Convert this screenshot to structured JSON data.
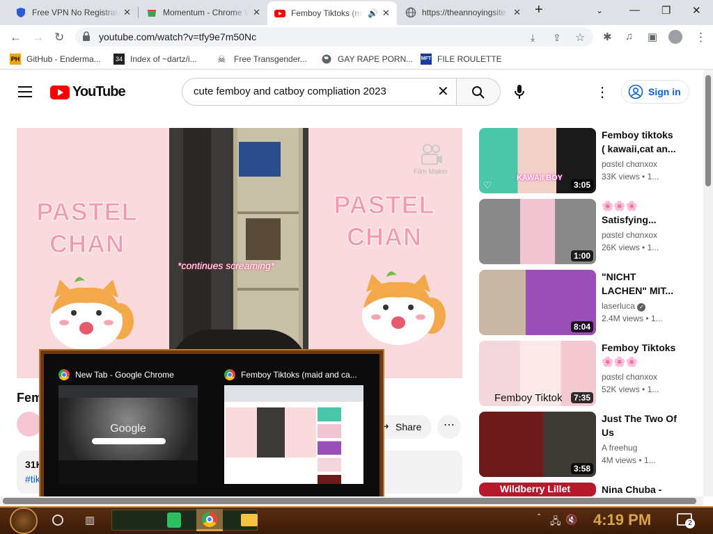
{
  "browser": {
    "tabs": [
      {
        "title": "Free VPN No Registration",
        "active": false
      },
      {
        "title": "Momentum - Chrome Web Store",
        "active": false
      },
      {
        "title": "Femboy Tiktoks (maid and catboy)",
        "active": true
      },
      {
        "title": "https://theannoyingsite.com",
        "active": false
      }
    ],
    "url": "youtube.com/watch?v=tfy9e7m50Nc",
    "bookmarks": [
      {
        "label": "GitHub - Enderma...",
        "icon": "PH"
      },
      {
        "label": "Index of ~dartz/i...",
        "icon": "34"
      },
      {
        "label": "Free Transgender...",
        "icon": "skull"
      },
      {
        "label": "GAY RAPE PORN...",
        "icon": "globe"
      },
      {
        "label": "FILE ROULETTE",
        "icon": "MFT"
      }
    ]
  },
  "youtube": {
    "logo_text": "YouTube",
    "search_query": "cute femboy and catboy compliation 2023",
    "sign_in": "Sign in",
    "video": {
      "left_text": "PASTEL\nCHAN",
      "right_text": "PASTEL\nCHAN",
      "caption": "*continues screaming*",
      "watermark": "Film Maker",
      "title_partial": "Fem",
      "stats_partial": "31K",
      "hashtag_partial": "#tik",
      "share": "Share"
    },
    "related": [
      {
        "title": "Femboy tiktoks ( kawaii,cat an...",
        "channel": "pαstєl chαnxox",
        "views": "33K views",
        "meta": "• 1...",
        "duration": "3:05",
        "thumb_text": "KAWAII BOY"
      },
      {
        "title": "🌸🌸🌸 Satisfying...",
        "channel": "pαstєl chαnxox",
        "views": "26K views",
        "meta": "• 1...",
        "duration": "1:00"
      },
      {
        "title": "\"NICHT LACHEN\" MIT...",
        "channel": "laserluca",
        "views": "2.4M views",
        "meta": "• 1...",
        "duration": "8:04",
        "verified": true
      },
      {
        "title": "Femboy Tiktoks 🌸🌸🌸",
        "channel": "pαstєl chαnxox",
        "views": "52K views",
        "meta": "• 1...",
        "duration": "7:35",
        "thumb_text": "Femboy Tiktok"
      },
      {
        "title": "Just The Two Of Us",
        "channel": "A freehug",
        "views": "4M views",
        "meta": "• 1...",
        "duration": "3:58"
      },
      {
        "title": "Nina Chuba -",
        "thumb_text": "Wildberry Lillet"
      }
    ]
  },
  "taskbar_preview": {
    "items": [
      {
        "title": "New Tab - Google Chrome"
      },
      {
        "title": "Femboy Tiktoks (maid and ca..."
      }
    ],
    "google_text": "Google"
  },
  "taskbar": {
    "time": "4:19 PM",
    "notifications": "2"
  },
  "colors": {
    "youtube_red": "#ff0000",
    "link_blue": "#065fd4",
    "pastel_pink": "#f49ab0",
    "taskbar_brown": "#5a2d10",
    "clock_gold": "#d9a548"
  }
}
